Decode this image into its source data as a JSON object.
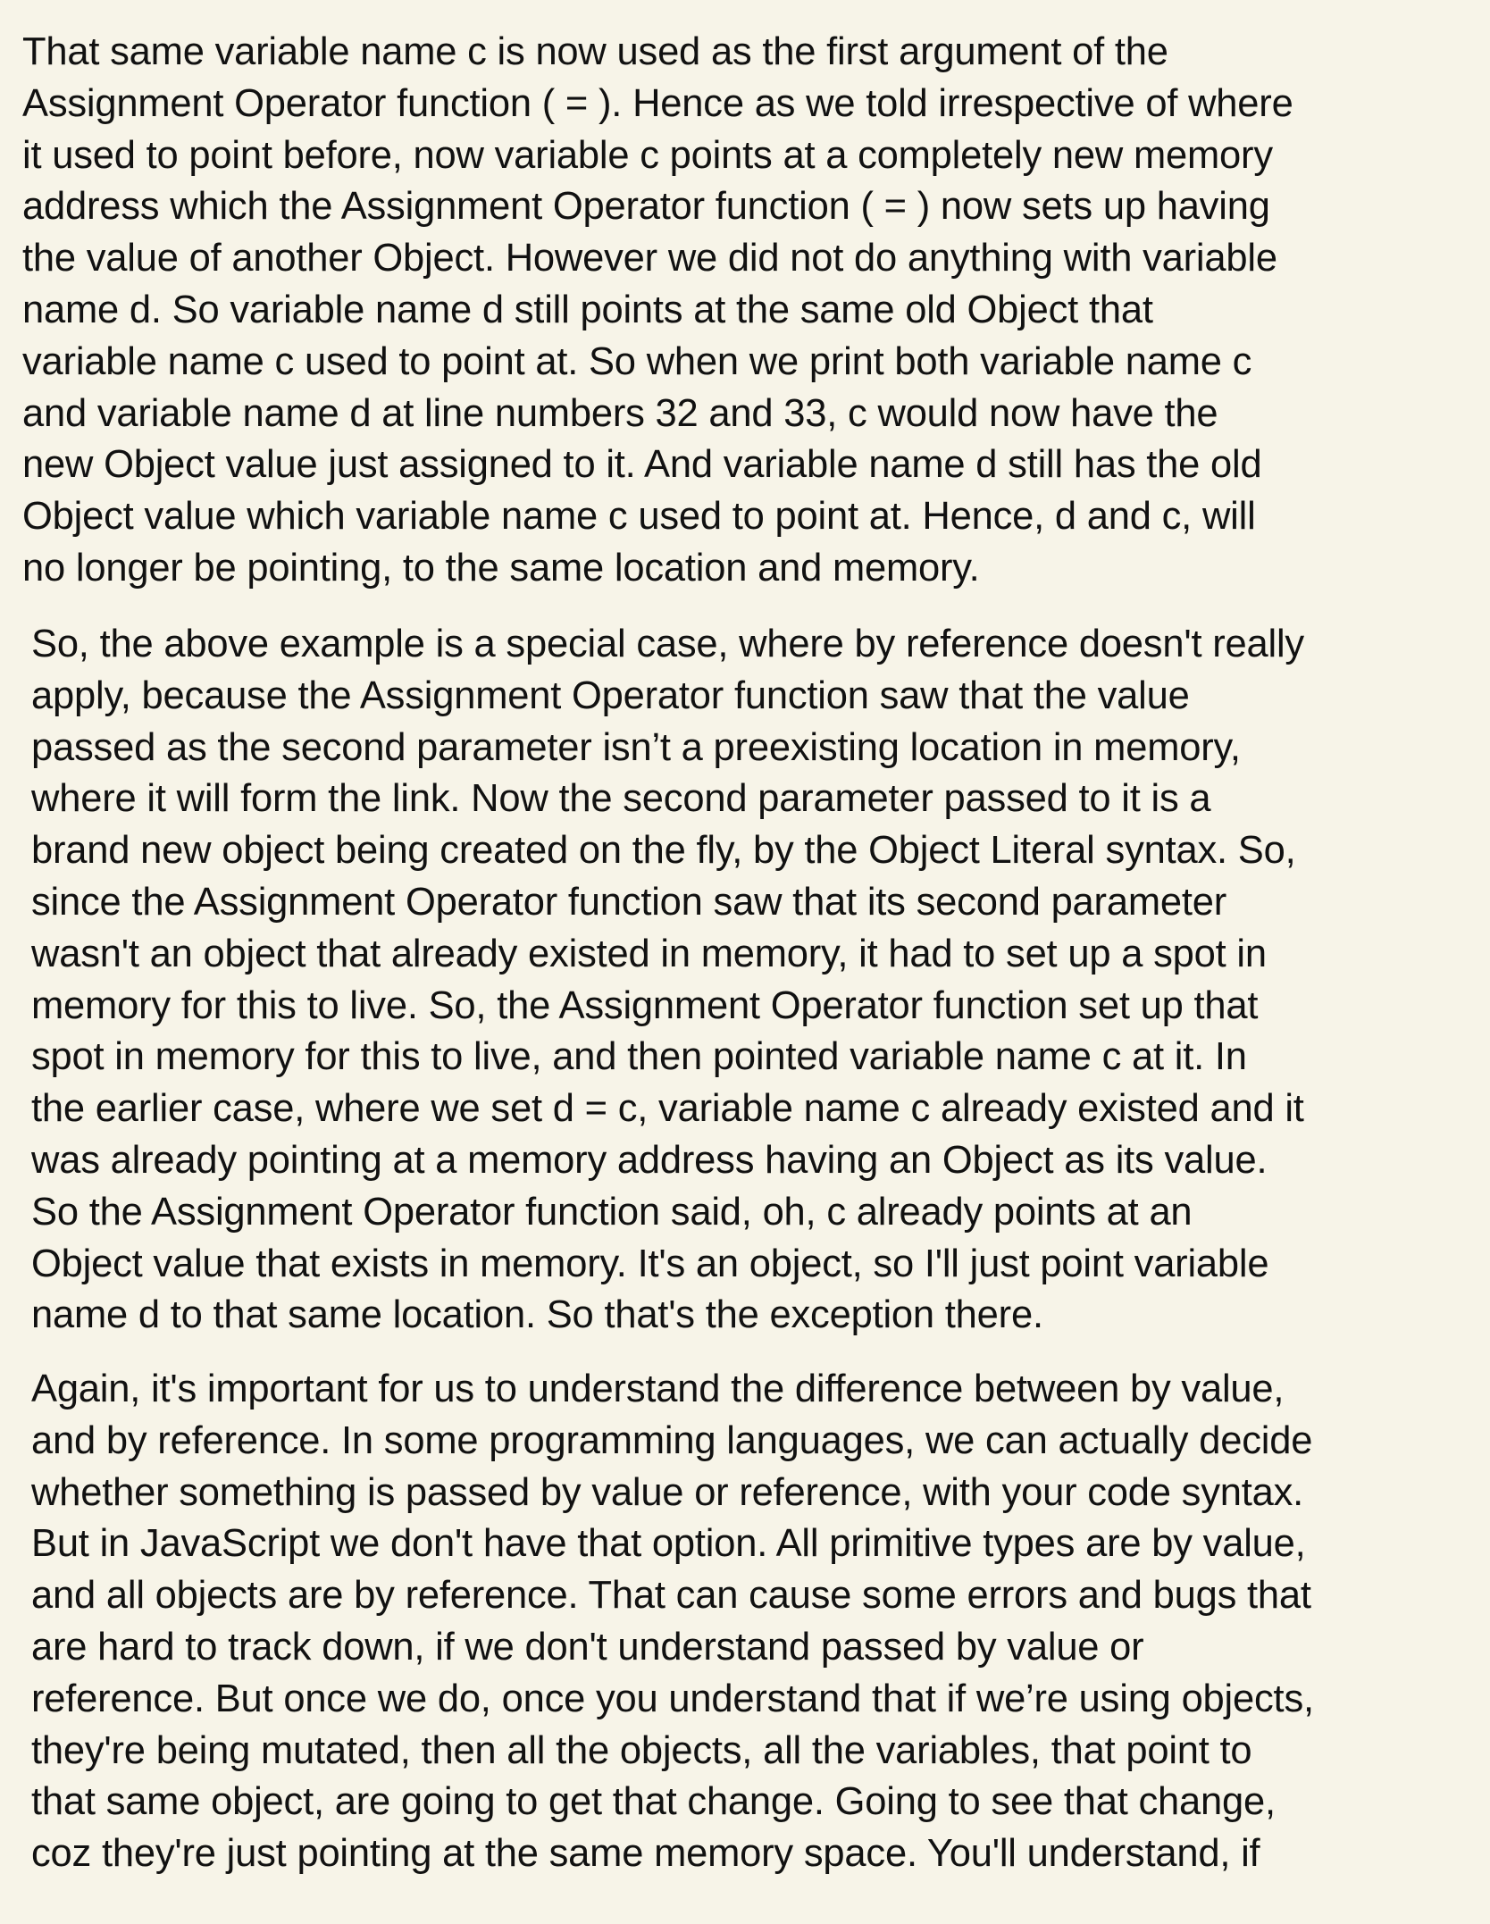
{
  "paragraphs": [
    {
      "lines": [
        "That same variable name c is now used as the first argument of the",
        "Assignment Operator function ( = ). Hence as we told irrespective of where",
        "it used to point before, now variable c points at a completely new memory",
        "address which the Assignment Operator function ( = ) now sets up having",
        "the value of another Object. However we did not do anything with variable",
        "name d. So variable name d still points at the same old Object that",
        "variable name c used to point at. So when we print both variable name c",
        "and variable name d at line numbers 32 and 33, c would now have the",
        "new Object value just assigned to it. And variable name d still has the old",
        "Object value which variable name c used to point at. Hence, d and c, will",
        "no longer be pointing, to the same location and memory."
      ]
    },
    {
      "lines": [
        "So, the above example is a special case, where by reference doesn't really",
        "apply, because the Assignment Operator function saw that the value",
        "passed as the second parameter isn’t  a preexisting location in memory,",
        "where it will form the link. Now the second parameter passed to it is a",
        "brand new object being created on the fly, by the Object Literal syntax. So,",
        "since the Assignment Operator function saw that its second parameter",
        "wasn't an object that already existed in memory, it had to set up a spot in",
        "memory for this to live. So, the Assignment Operator function set up that",
        "spot in memory for this to live, and then pointed variable name c at it. In",
        "the earlier case, where we set d = c, variable name c already existed and it",
        "was already pointing at a memory address having an Object as its value.",
        "So the Assignment Operator function said, oh, c already points at an",
        "Object value that exists in memory. It's an object, so I'll just point variable",
        "name d to that same location. So that's the exception there."
      ]
    },
    {
      "lines": [
        "Again, it's important for us to understand the difference between by value,",
        "and by reference. In some programming languages, we can actually decide",
        "whether something is passed by value or reference, with your code syntax.",
        "But in JavaScript we don't have that option. All primitive types are by value,",
        "and all objects are by reference. That can cause some errors and bugs that",
        "are hard to track down, if we don't understand passed by value or",
        "reference. But once we do, once you understand that if we’re using objects,",
        "they're being mutated, then all the objects, all the variables, that point to",
        "that same object, are going to get that change. Going to see that change,",
        "coz they're just pointing at the same memory space. You'll understand, if"
      ]
    }
  ]
}
